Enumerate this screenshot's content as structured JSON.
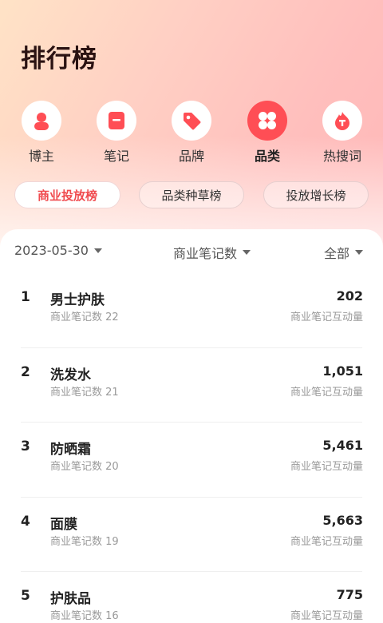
{
  "page_title": "排行榜",
  "categories": [
    {
      "label": "博主",
      "icon": "person-icon",
      "active": false
    },
    {
      "label": "笔记",
      "icon": "note-icon",
      "active": false
    },
    {
      "label": "品牌",
      "icon": "tag-icon",
      "active": false
    },
    {
      "label": "品类",
      "icon": "grid-icon",
      "active": true
    },
    {
      "label": "热搜词",
      "icon": "flame-icon",
      "active": false
    }
  ],
  "tabs": [
    {
      "label": "商业投放榜",
      "active": true
    },
    {
      "label": "品类种草榜",
      "active": false
    },
    {
      "label": "投放增长榜",
      "active": false
    }
  ],
  "filters": {
    "date": "2023-05-30",
    "metric": "商业笔记数",
    "scope": "全部"
  },
  "rows": [
    {
      "rank": "1",
      "name": "男士护肤",
      "sub": "商业笔记数 22",
      "value": "202",
      "value_label": "商业笔记互动量"
    },
    {
      "rank": "2",
      "name": "洗发水",
      "sub": "商业笔记数 21",
      "value": "1,051",
      "value_label": "商业笔记互动量"
    },
    {
      "rank": "3",
      "name": "防晒霜",
      "sub": "商业笔记数 20",
      "value": "5,461",
      "value_label": "商业笔记互动量"
    },
    {
      "rank": "4",
      "name": "面膜",
      "sub": "商业笔记数 19",
      "value": "5,663",
      "value_label": "商业笔记互动量"
    },
    {
      "rank": "5",
      "name": "护肤品",
      "sub": "商业笔记数 16",
      "value": "775",
      "value_label": "商业笔记互动量"
    }
  ],
  "colors": {
    "accent": "#ff4e55",
    "active_tab_text": "#f04b4f"
  }
}
